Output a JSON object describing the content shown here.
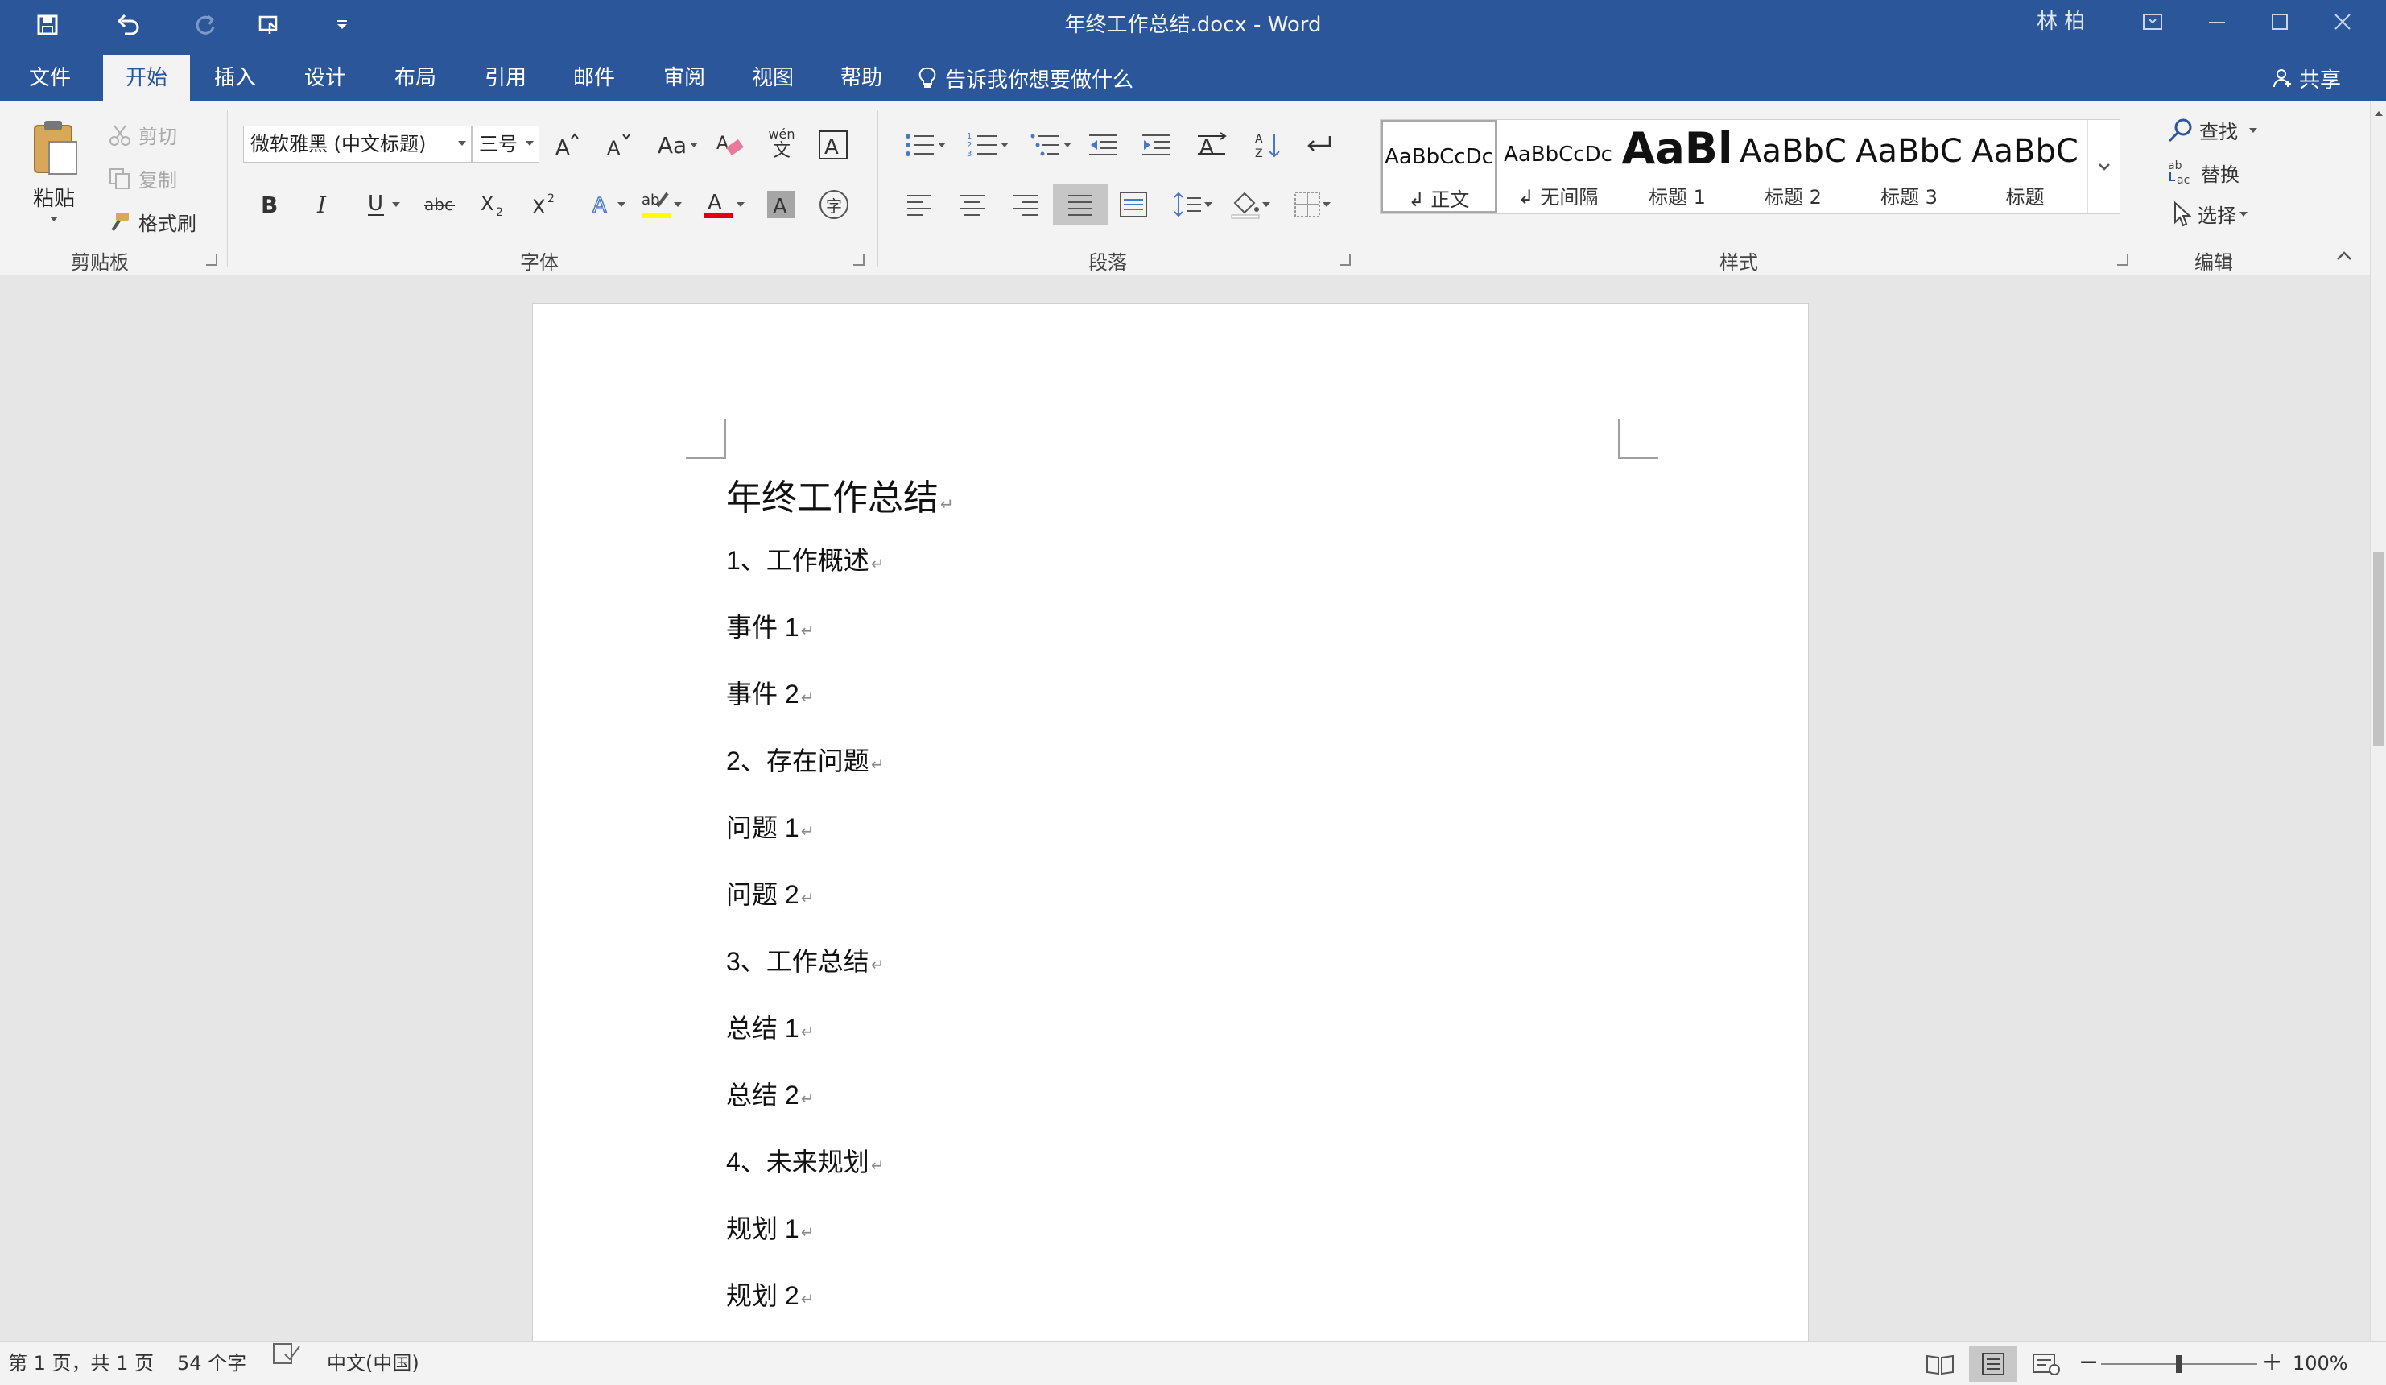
{
  "titlebar": {
    "doc_title": "年终工作总结.docx  -  Word",
    "user": "林 柏",
    "qat_icons": [
      "save-icon",
      "undo-icon",
      "redo-icon",
      "touch-mode-icon",
      "customize-qat-icon"
    ],
    "window_controls": [
      "ribbon-display-icon",
      "minimize-icon",
      "maximize-icon",
      "close-icon"
    ]
  },
  "tabs": [
    "文件",
    "开始",
    "插入",
    "设计",
    "布局",
    "引用",
    "邮件",
    "审阅",
    "视图",
    "帮助"
  ],
  "active_tab": "开始",
  "tell_me": "告诉我你想要做什么",
  "share": "共享",
  "clipboard": {
    "paste": "粘贴",
    "cut": "剪切",
    "copy": "复制",
    "format_painter": "格式刷",
    "label": "剪贴板"
  },
  "font": {
    "font_name": "微软雅黑 (中文标题)",
    "font_size": "三号",
    "label": "字体",
    "phonetic_top": "wén",
    "phonetic_bottom": "文",
    "case_label": "Aa",
    "enclose_char": "字",
    "highlight_color": "#ffff00",
    "font_color": "#e00000"
  },
  "paragraph": {
    "label": "段落"
  },
  "styles": {
    "label": "样式",
    "items": [
      {
        "preview": "AaBbCcDc",
        "label": "↲ 正文"
      },
      {
        "preview": "AaBbCcDc",
        "label": "↲ 无间隔"
      },
      {
        "preview": "AaBl",
        "label": "标题 1"
      },
      {
        "preview": "AaBbC",
        "label": "标题 2"
      },
      {
        "preview": "AaBbC",
        "label": "标题 3"
      },
      {
        "preview": "AaBbC",
        "label": "标题"
      }
    ]
  },
  "editing": {
    "find": "查找",
    "replace": "替换",
    "select": "选择",
    "label": "编辑"
  },
  "document": {
    "title": "年终工作总结",
    "paragraphs": [
      "1、工作概述",
      "事件 1",
      "事件 2",
      "2、存在问题",
      "问题 1",
      "问题 2",
      "3、工作总结",
      "总结 1",
      "总结 2",
      "4、未来规划",
      "规划 1",
      "规划 2"
    ],
    "paragraph_mark": "↵"
  },
  "statusbar": {
    "page": "第 1 页，共 1 页",
    "words": "54 个字",
    "language": "中文(中国)",
    "zoom": "100%",
    "zoom_level": 1.0,
    "view_modes": [
      "read-mode-icon",
      "print-layout-icon",
      "web-layout-icon"
    ]
  },
  "colors": {
    "accent": "#2b579a",
    "ribbon_bg": "#f3f3f3",
    "canvas_bg": "#e6e6e6"
  }
}
